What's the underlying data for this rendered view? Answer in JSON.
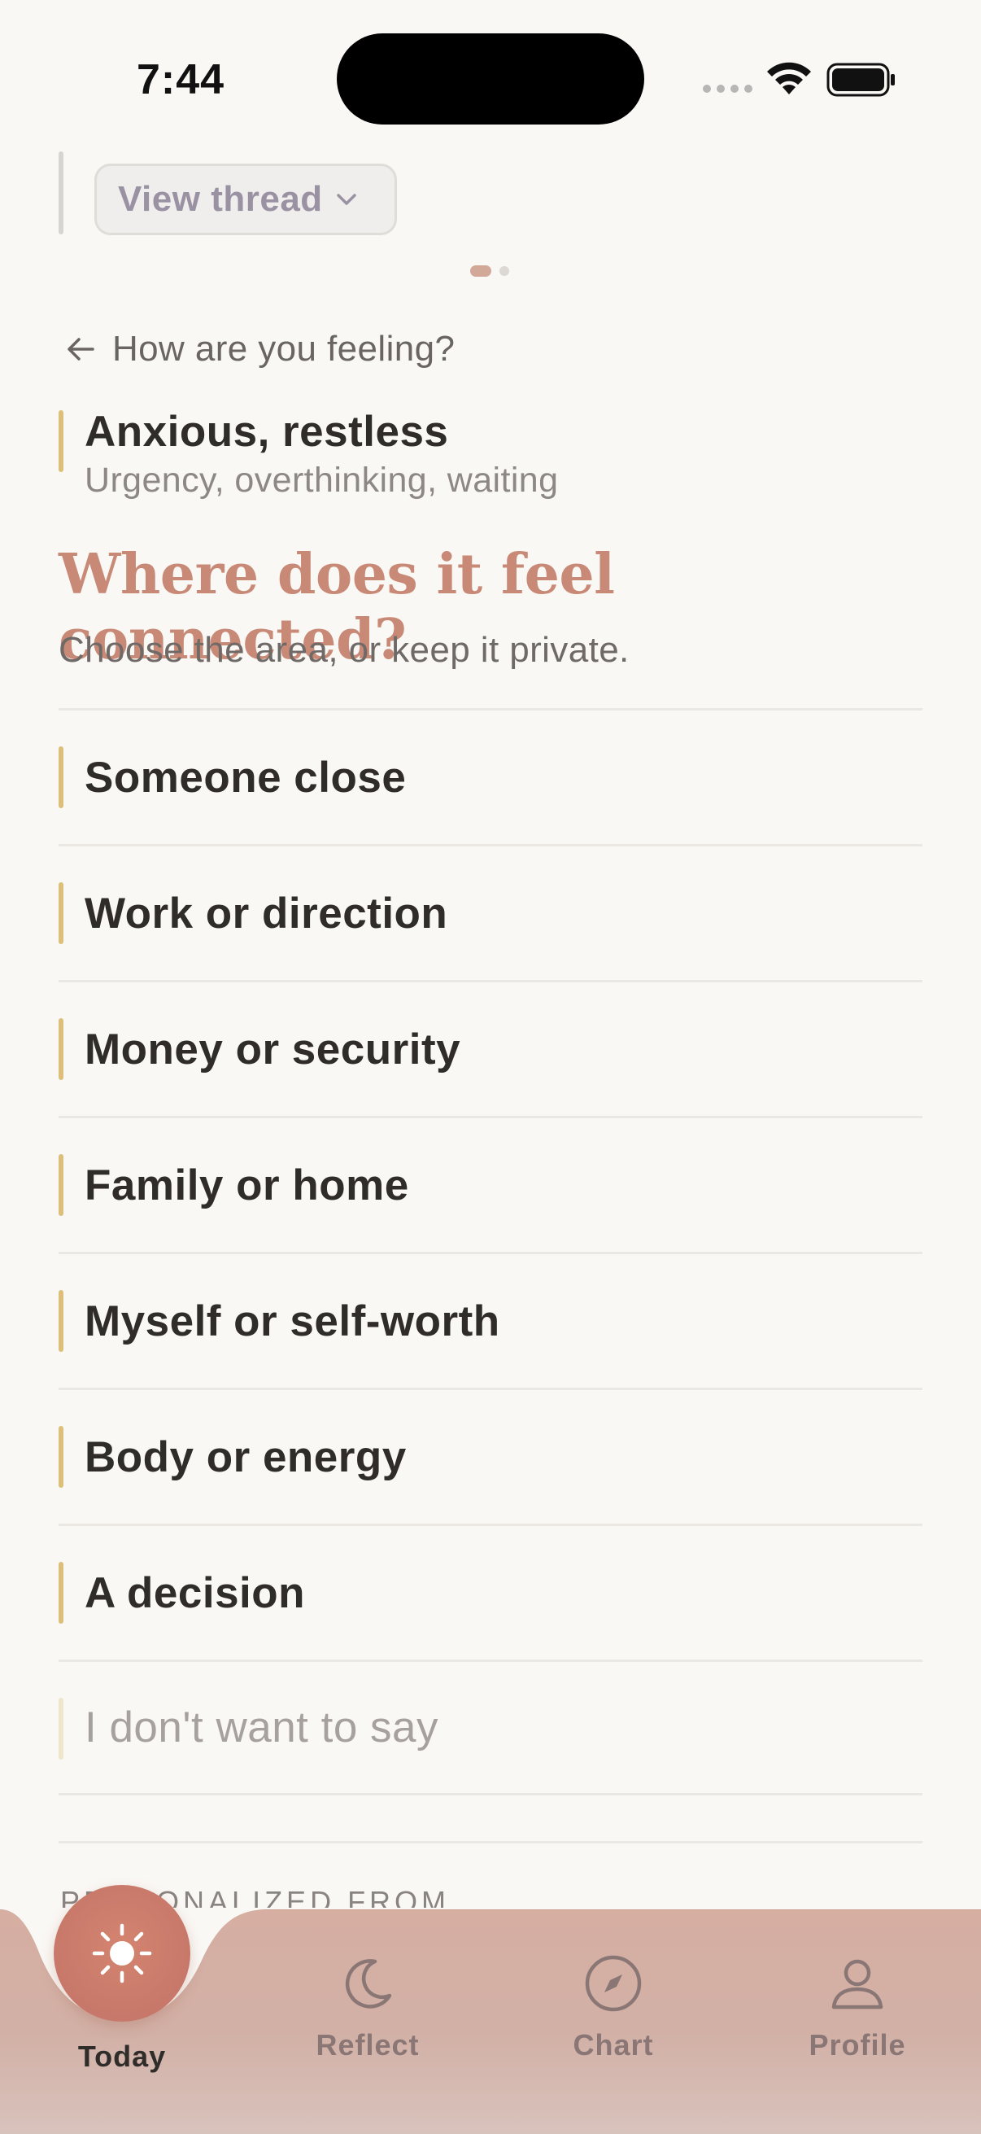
{
  "status_bar": {
    "time": "7:44"
  },
  "thread": {
    "button_label": "View thread"
  },
  "back": {
    "label": "How are you feeling?"
  },
  "feeling": {
    "title": "Anxious, restless",
    "subtitle": "Urgency, overthinking, waiting"
  },
  "question": {
    "title": "Where does it feel connected?",
    "subtitle": "Choose the area, or keep it private."
  },
  "options": [
    {
      "label": "Someone close"
    },
    {
      "label": "Work or direction"
    },
    {
      "label": "Money or security"
    },
    {
      "label": "Family or home"
    },
    {
      "label": "Myself or self-worth"
    },
    {
      "label": "Body or energy"
    },
    {
      "label": "A decision"
    },
    {
      "label": "I don't want to say"
    }
  ],
  "section": {
    "personalized_label": "PERSONALIZED FROM"
  },
  "tabbar": {
    "today": "Today",
    "reflect": "Reflect",
    "chart": "Chart",
    "profile": "Profile",
    "icons": [
      "sun-icon",
      "moon-icon",
      "compass-icon",
      "person-icon"
    ]
  },
  "colors": {
    "background": "#faf8f5",
    "accent_heading": "#c88a76",
    "option_marker": "#dcc07a",
    "tabbar": "#d6aea2",
    "today_active": "#c7786a"
  }
}
